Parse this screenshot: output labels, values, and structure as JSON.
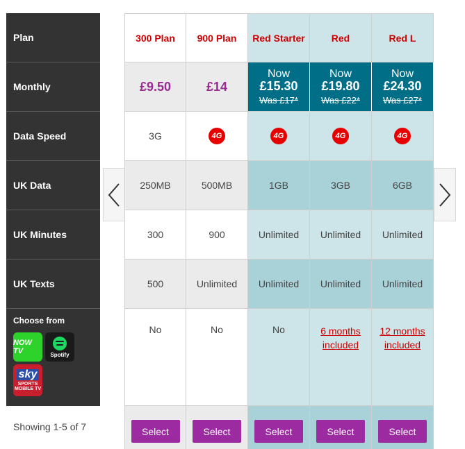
{
  "labels": {
    "plan": "Plan",
    "monthly": "Monthly",
    "data_speed": "Data Speed",
    "uk_data": "UK Data",
    "uk_minutes": "UK Minutes",
    "uk_texts": "UK Texts",
    "choose_from": "Choose from"
  },
  "apps": {
    "now": "NOW TV",
    "spotify": "Spotify",
    "sky_top": "sky",
    "sky_mid": "SPORTS",
    "sky_bottom": "MOBILE TV"
  },
  "pagination": {
    "showing": "Showing 1-5 of 7"
  },
  "badge_text": "4G",
  "plans": [
    {
      "name": "300 Plan",
      "price": "£9.50",
      "data_speed": "3G",
      "uk_data": "250MB",
      "uk_minutes": "300",
      "uk_texts": "500",
      "extras": "No",
      "button": "Select"
    },
    {
      "name": "900 Plan",
      "price": "£14",
      "data_speed": "4G",
      "uk_data": "500MB",
      "uk_minutes": "900",
      "uk_texts": "Unlimited",
      "extras": "No",
      "button": "Select"
    },
    {
      "name": "Red Starter",
      "now": "Now",
      "price": "£15.30",
      "was": "Was £17*",
      "data_speed": "4G",
      "uk_data": "1GB",
      "uk_minutes": "Unlimited",
      "uk_texts": "Unlimited",
      "extras": "No",
      "button": "Select"
    },
    {
      "name": "Red",
      "now": "Now",
      "price": "£19.80",
      "was": "Was £22*",
      "data_speed": "4G",
      "uk_data": "3GB",
      "uk_minutes": "Unlimited",
      "uk_texts": "Unlimited",
      "extras_line1": "6 months",
      "extras_line2": "included",
      "button": "Select"
    },
    {
      "name": "Red L",
      "now": "Now",
      "price": "£24.30",
      "was": "Was £27*",
      "data_speed": "4G",
      "uk_data": "6GB",
      "uk_minutes": "Unlimited",
      "uk_texts": "Unlimited",
      "extras_line1": "12 months",
      "extras_line2": "included",
      "button": "Select"
    }
  ],
  "colors": {
    "label_bg": "#333333",
    "accent_purple": "#9c2aa0",
    "price_purple": "#9a2b94",
    "plan_red": "#cc0000",
    "offer_teal": "#006e86",
    "red_light": "#cde4e8",
    "red_dark": "#a9d1d8"
  }
}
